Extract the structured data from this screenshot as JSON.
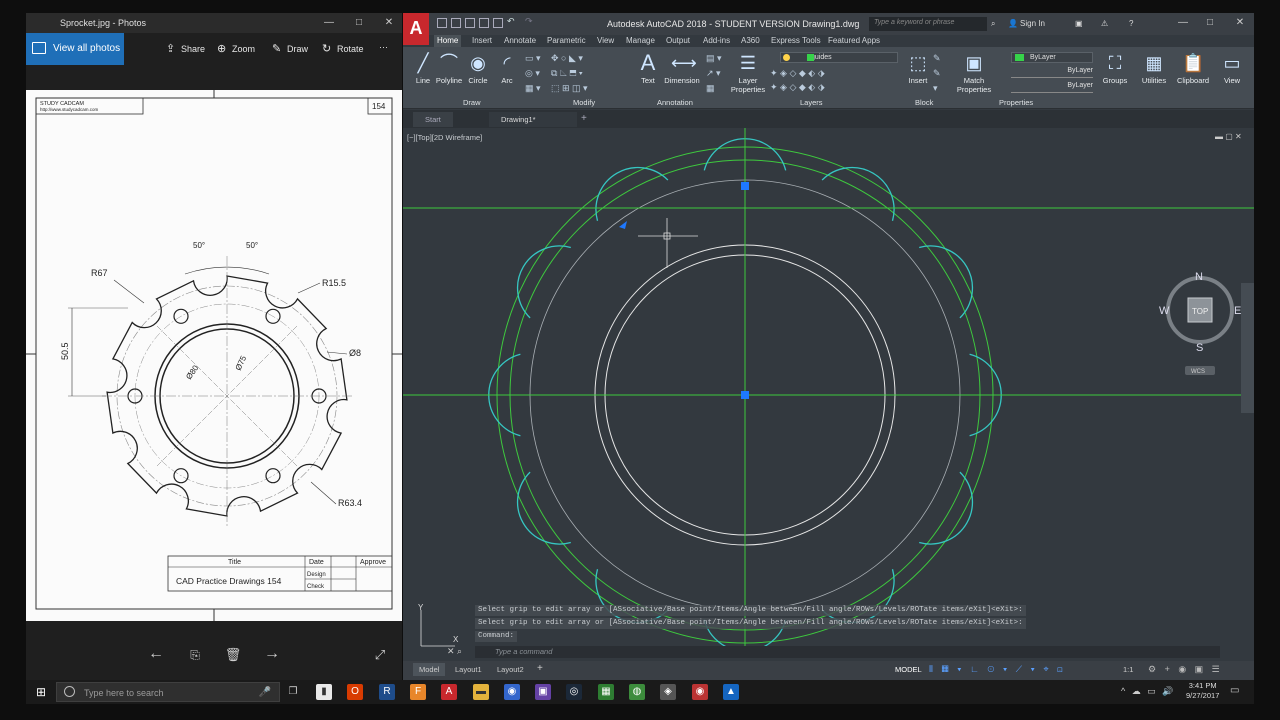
{
  "photos": {
    "window_title": "Sprocket.jpg - Photos",
    "view_all": "View all photos",
    "share": "Share",
    "zoom": "Zoom",
    "draw": "Draw",
    "rotate": "Rotate",
    "more": "···"
  },
  "drawing": {
    "company": "STUDY CADCAM",
    "url": "http://www.studycadcam.com",
    "number": "154",
    "dim_r67": "R67",
    "dim_r15_5": "R15.5",
    "dim_d8": "Ø8",
    "dim_r63_4": "R63.4",
    "dim_50_5": "50.5",
    "dim_d80": "Ø80",
    "dim_d75": "Ø75",
    "angle1": "50°",
    "angle2": "50°",
    "title_label": "Title",
    "date_label": "Date",
    "approve_label": "Approve",
    "design_label": "Design",
    "check_label": "Check",
    "title_value": "CAD Practice Drawings 154"
  },
  "acad": {
    "window_title": "Autodesk AutoCAD 2018 -  STUDENT VERSION     Drawing1.dwg",
    "app_letter": "A",
    "search_placeholder": "Type a keyword or phrase",
    "sign_in": "Sign In",
    "tabs": [
      "Home",
      "Insert",
      "Annotate",
      "Parametric",
      "View",
      "Manage",
      "Output",
      "Add-ins",
      "A360",
      "Express Tools",
      "Featured Apps"
    ],
    "draw_tools": [
      "Line",
      "Polyline",
      "Circle",
      "Arc"
    ],
    "text_btn": "Text",
    "dimension_btn": "Dimension",
    "layer_props": [
      "Layer",
      "Properties"
    ],
    "insert_btn": "Insert",
    "match_props": [
      "Match",
      "Properties"
    ],
    "groups": "Groups",
    "utilities": "Utilities",
    "clipboard": "Clipboard",
    "view": "View",
    "panels": [
      "Draw",
      "Modify",
      "Annotation",
      "Layers",
      "Block",
      "Properties"
    ],
    "layer_value": "guides",
    "bylayer": [
      "ByLayer",
      "ByLayer",
      "ByLayer"
    ],
    "doc_tabs": [
      "Start",
      "Drawing1*"
    ],
    "viewport_label": "[−][Top][2D Wireframe]",
    "viewcube": {
      "n": "N",
      "s": "S",
      "e": "E",
      "w": "W",
      "top": "TOP",
      "wcs": "WCS"
    },
    "command_lines": [
      "Select grip to edit array or [ASsociative/Base point/Items/Angle between/Fill angle/ROWs/Levels/ROTate items/eXit]<eXit>:",
      "Select grip to edit array or [ASsociative/Base point/Items/Angle between/Fill angle/ROWs/Levels/ROTate items/eXit]<eXit>:",
      "Command:"
    ],
    "command_placeholder": "Type a command",
    "layout_tabs": [
      "Model",
      "Layout1",
      "Layout2"
    ],
    "model_label": "MODEL",
    "scale": "1:1",
    "colors": {
      "green": "#3ec93e",
      "cyan": "#36c6c2",
      "white": "#e6e6e6",
      "grip": "#1e78ff",
      "bg": "#33393f"
    }
  },
  "taskbar": {
    "search_placeholder": "Type here to search",
    "time": "3:41 PM",
    "date": "9/27/2017"
  }
}
